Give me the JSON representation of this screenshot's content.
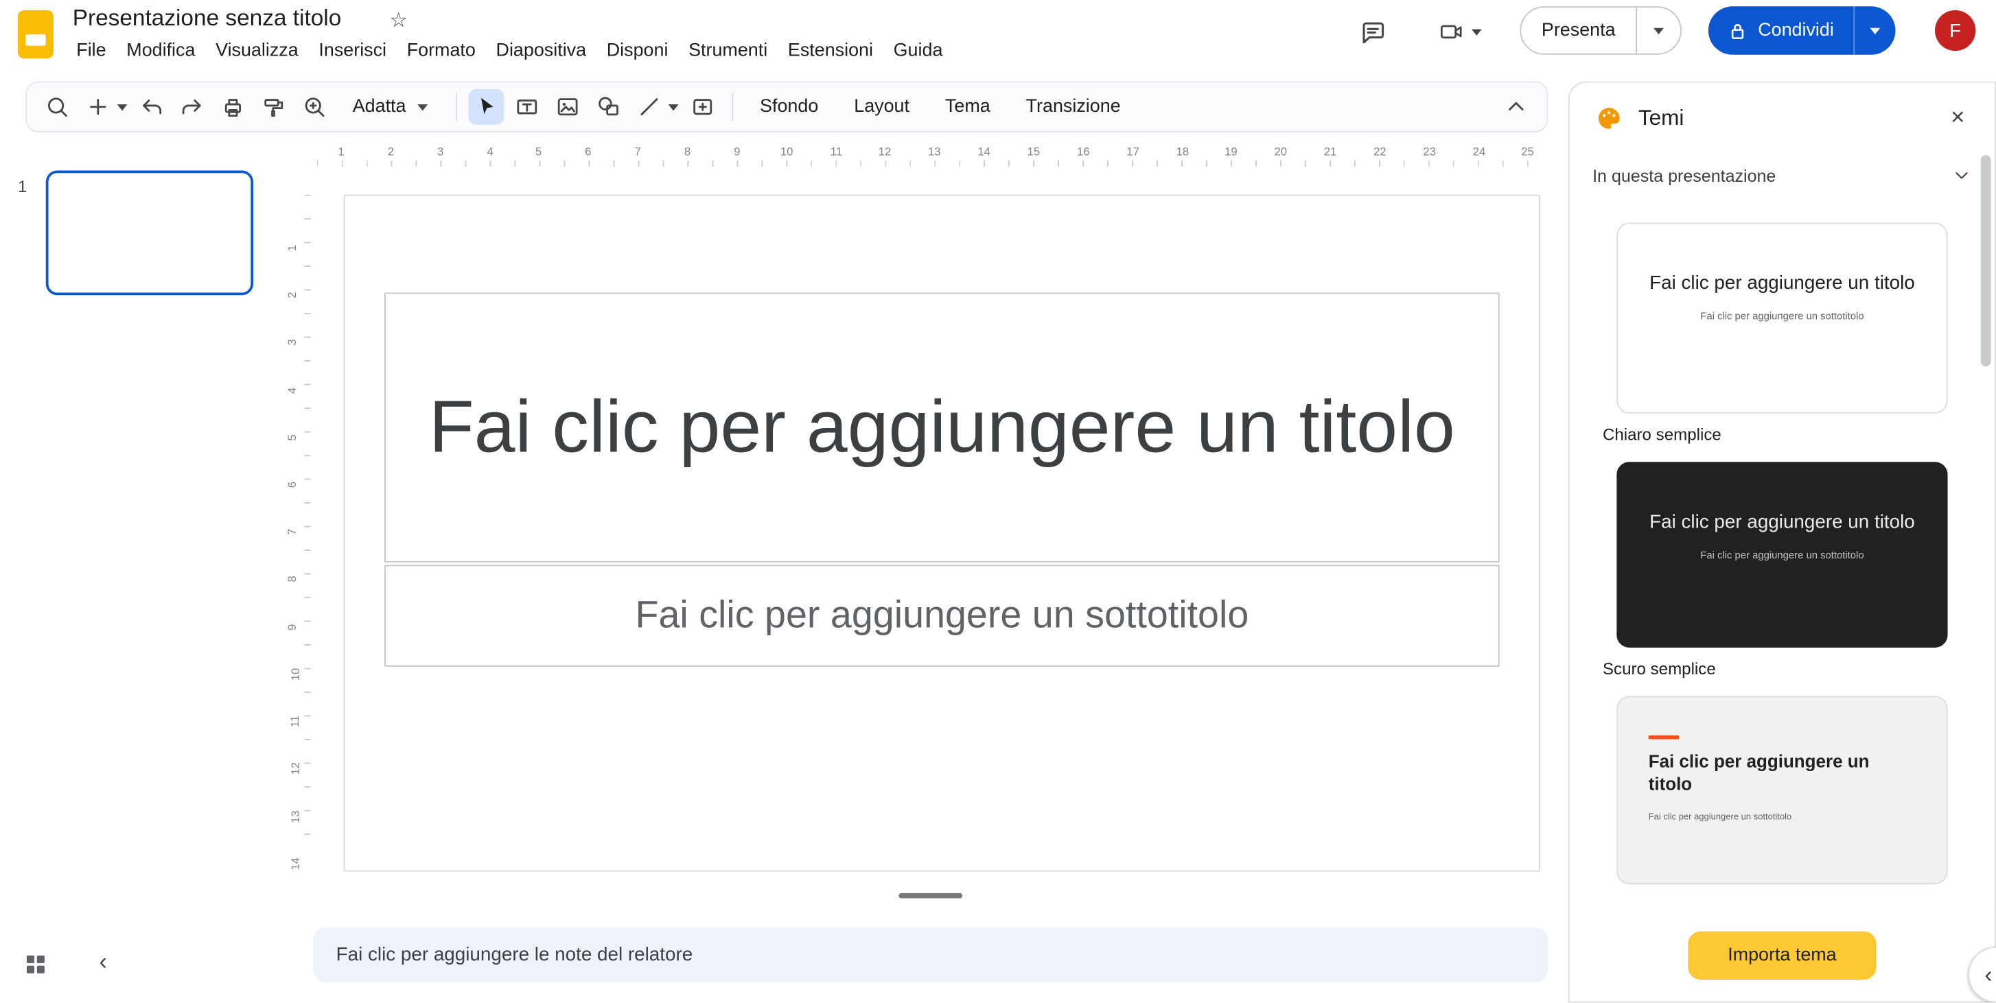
{
  "window": {
    "title": "Presentazione senza titolo"
  },
  "menubar": {
    "items": [
      "File",
      "Modifica",
      "Visualizza",
      "Inserisci",
      "Formato",
      "Diapositiva",
      "Disponi",
      "Strumenti",
      "Estensioni",
      "Guida"
    ]
  },
  "actions": {
    "present": "Presenta",
    "share": "Condividi",
    "avatar_initial": "F"
  },
  "toolbar": {
    "fit": "Adatta",
    "background": "Sfondo",
    "layout": "Layout",
    "theme": "Tema",
    "transition": "Transizione"
  },
  "filmstrip": {
    "slide_number": "1"
  },
  "slide": {
    "title_placeholder": "Fai clic per aggiungere un titolo",
    "subtitle_placeholder": "Fai clic per aggiungere un sottotitolo"
  },
  "notes": {
    "placeholder": "Fai clic per aggiungere le note del relatore"
  },
  "rulers": {
    "horizontal": [
      "1",
      "2",
      "3",
      "4",
      "5",
      "6",
      "7",
      "8",
      "9",
      "10",
      "11",
      "12",
      "13",
      "14",
      "15",
      "16",
      "17",
      "18",
      "19",
      "20",
      "21",
      "22",
      "23",
      "24",
      "25"
    ],
    "vertical": [
      "1",
      "2",
      "3",
      "4",
      "5",
      "6",
      "7",
      "8",
      "9",
      "10",
      "11",
      "12",
      "13",
      "14"
    ]
  },
  "themes_panel": {
    "title": "Temi",
    "section_label": "In questa presentazione",
    "import_button": "Importa tema",
    "themes": [
      {
        "name": "Chiaro semplice",
        "card_title": "Fai clic per aggiungere un titolo",
        "card_subtitle": "Fai clic per aggiungere un sottotitolo"
      },
      {
        "name": "Scuro semplice",
        "card_title": "Fai clic per aggiungere un titolo",
        "card_subtitle": "Fai clic per aggiungere un sottotitolo"
      },
      {
        "name": "",
        "card_title": "Fai clic per aggiungere un titolo",
        "card_subtitle": "Fai clic per aggiungere un sottotitolo"
      }
    ]
  },
  "icons": {
    "star": "☆",
    "close": "×",
    "chevron_left": "‹",
    "expand_circle": "‹"
  },
  "colors": {
    "accent_blue": "#0b57d0",
    "selected_tool_bg": "#d3e3fd",
    "share_button": "#0b57d0",
    "import_button": "#fcc934",
    "logo_yellow": "#fbbc04",
    "avatar": "#c5221f",
    "notes_bg": "#eef3fb",
    "dark_theme_card": "#212121",
    "accent_theme_line": "#f4511e"
  }
}
